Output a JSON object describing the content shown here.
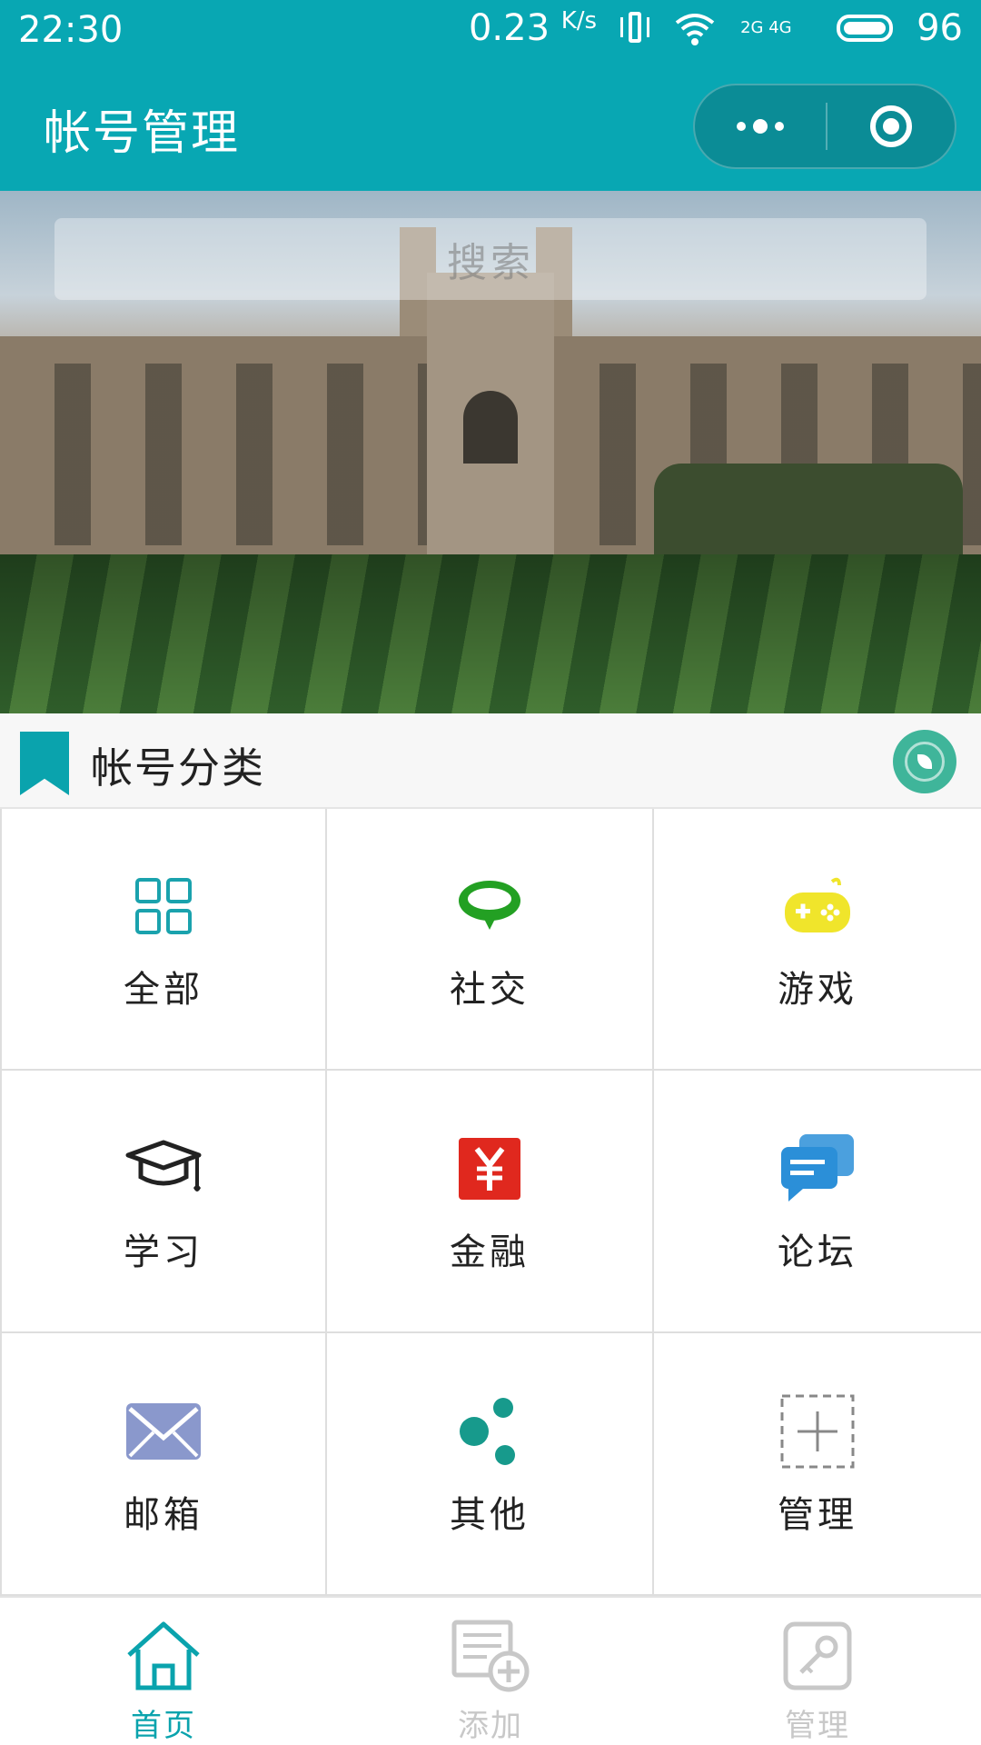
{
  "status_bar": {
    "time": "22:30",
    "net_speed": "0.23",
    "net_unit": "K/s",
    "signal_text": "2G 4G",
    "battery": "96"
  },
  "navbar": {
    "title": "帐号管理",
    "more_icon": "more-dots-icon",
    "close_icon": "target-close-icon",
    "color": "#08a7b3"
  },
  "search": {
    "placeholder": "搜索"
  },
  "section": {
    "title": "帐号分类",
    "accent": "#0aa3ad"
  },
  "categories": [
    {
      "label": "全部",
      "icon": "grid-icon",
      "color": "#1aa2ad"
    },
    {
      "label": "社交",
      "icon": "chat-bubble-icon",
      "color": "#23a023"
    },
    {
      "label": "游戏",
      "icon": "gamepad-icon",
      "color": "#f0e52b"
    },
    {
      "label": "学习",
      "icon": "graduation-cap-icon",
      "color": "#222222"
    },
    {
      "label": "金融",
      "icon": "yuan-icon",
      "color": "#e0281e"
    },
    {
      "label": "论坛",
      "icon": "forum-chat-icon",
      "color": "#2b8fd8"
    },
    {
      "label": "邮箱",
      "icon": "mail-icon",
      "color": "#8a98cc"
    },
    {
      "label": "其他",
      "icon": "share-dots-icon",
      "color": "#179a8c"
    },
    {
      "label": "管理",
      "icon": "add-dashed-icon",
      "color": "#888888"
    }
  ],
  "tabbar": {
    "items": [
      {
        "label": "首页",
        "icon": "home-icon",
        "active": true,
        "color": "#0aa3ad"
      },
      {
        "label": "添加",
        "icon": "add-note-icon",
        "active": false,
        "color": "#c8c8c8"
      },
      {
        "label": "管理",
        "icon": "key-icon",
        "active": false,
        "color": "#c8c8c8"
      }
    ]
  }
}
